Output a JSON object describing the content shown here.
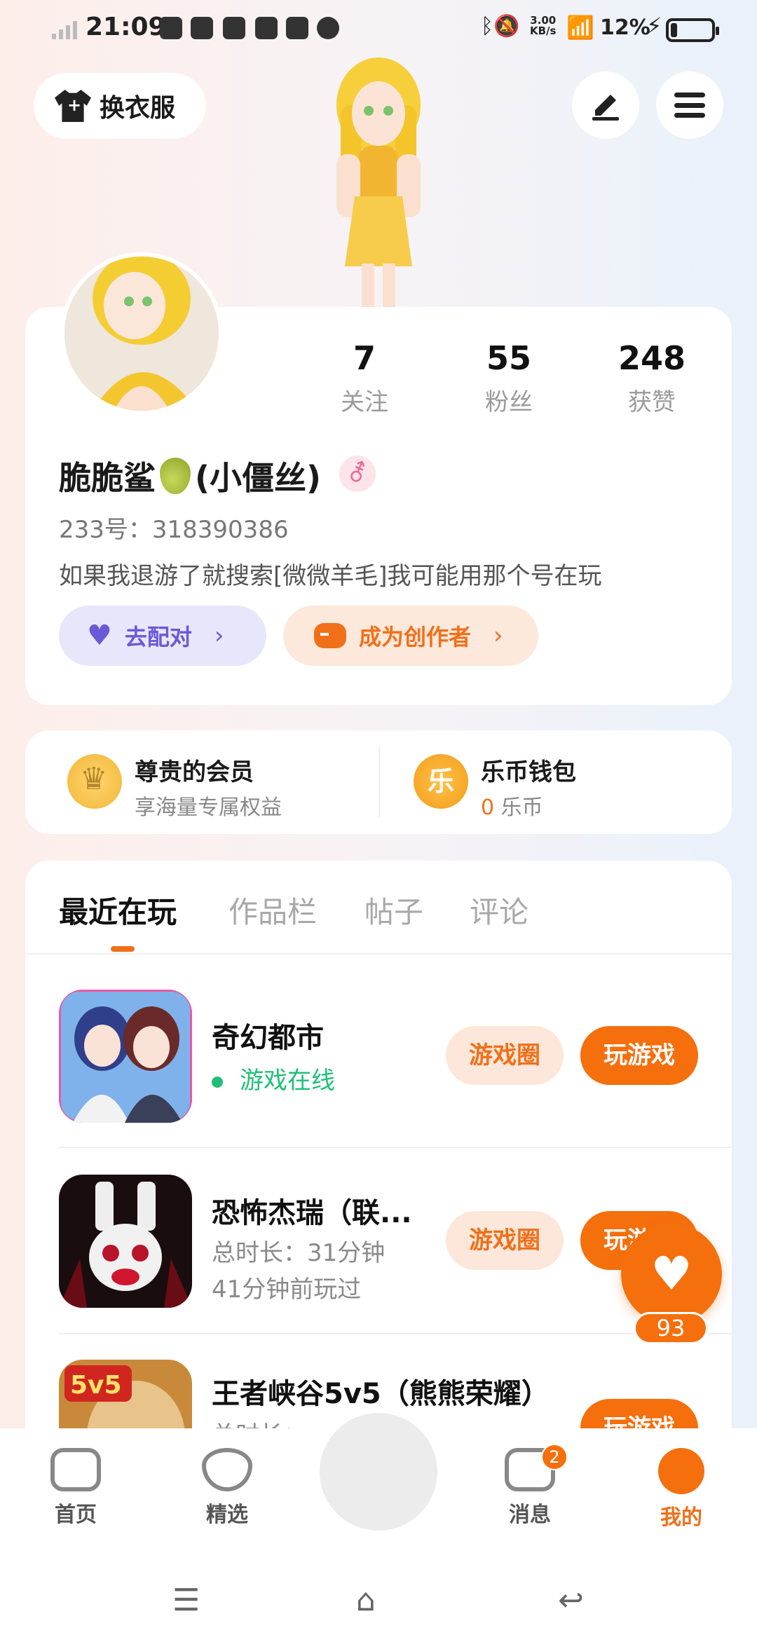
{
  "status_bar": {
    "time": "21:09",
    "network_speed": "3.00\nKB/s",
    "battery": "12%"
  },
  "top": {
    "change_clothes": "换衣服"
  },
  "profile": {
    "stats": [
      {
        "value": "7",
        "label": "关注"
      },
      {
        "value": "55",
        "label": "粉丝"
      },
      {
        "value": "248",
        "label": "获赞"
      }
    ],
    "name_prefix": "脆脆鲨",
    "name_suffix": "(小僵丝)",
    "gender_symbol": "⚦",
    "uid": "233号：318390386",
    "bio": "如果我退游了就搜索[微微羊毛]我可能用那个号在玩",
    "match_label": "去配对",
    "creator_label": "成为创作者"
  },
  "member": {
    "vip_title": "尊贵的会员",
    "vip_sub": "享海量专属权益",
    "wallet_title": "乐币钱包",
    "wallet_icon": "乐",
    "wallet_amount": "0",
    "wallet_unit": "乐币"
  },
  "tabs": [
    "最近在玩",
    "作品栏",
    "帖子",
    "评论"
  ],
  "games": [
    {
      "title": "奇幻都市",
      "online": "游戏在线",
      "circle": "游戏圈",
      "play": "玩游戏"
    },
    {
      "title": "恐怖杰瑞（联...",
      "duration": "总时长：31分钟",
      "last": "41分钟前玩过",
      "circle": "游戏圈",
      "play": "玩游戏"
    },
    {
      "title": "王者峡谷5v5（熊熊荣耀）",
      "duration": "总时长：",
      "play": "玩游戏"
    }
  ],
  "like": {
    "count": "93"
  },
  "nav": {
    "items": [
      "首页",
      "精选",
      "消息",
      "我的"
    ],
    "message_badge": "2"
  },
  "colors": {
    "accent": "#F56F0D",
    "online": "#1FBF76",
    "match": "#6A5AD6"
  }
}
